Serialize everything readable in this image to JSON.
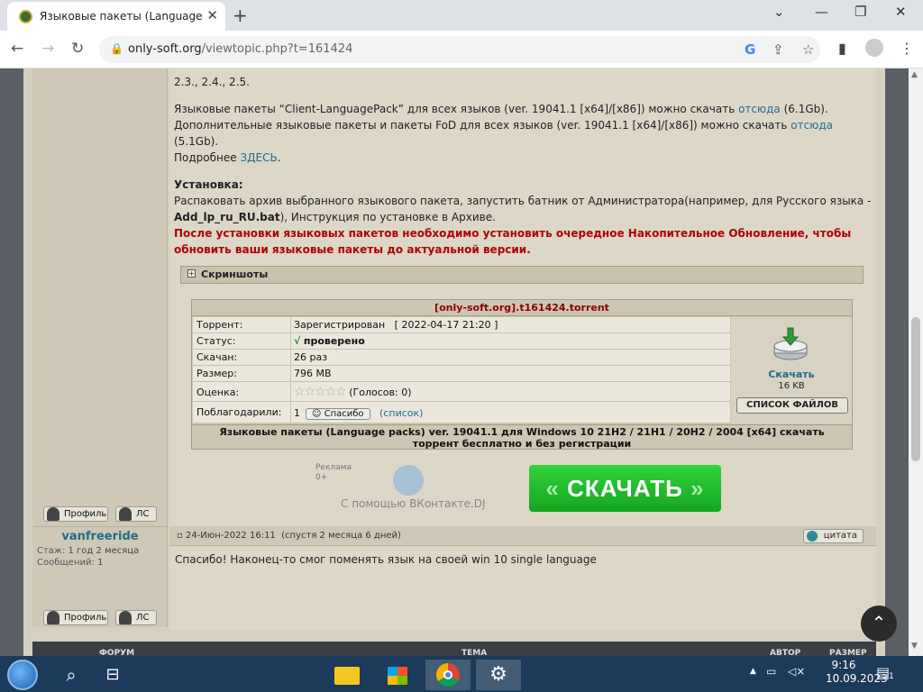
{
  "browser": {
    "tab_title": "Языковые пакеты (Language pa",
    "url_host": "only-soft.org",
    "url_path": "/viewtopic.php?t=161424"
  },
  "post": {
    "line_top": "2.3., 2.4., 2.5.",
    "lp_prefix": "Языковые пакеты “Client-LanguagePack” для всех языков (ver. 19041.1 [x64]/[x86]) можно скачать ",
    "lp_link": "отсюда",
    "lp_suffix": " (6.1Gb).",
    "fod_prefix": "Дополнительные языковые пакеты и пакеты FoD для всех языков (ver. 19041.1 [x64]/[x86]) можно скачать ",
    "fod_link": "отсюда",
    "fod_suffix": "(5.1Gb).",
    "more_prefix": "Подробнее ",
    "more_link": "ЗДЕСЬ",
    "more_suffix": ".",
    "install_title": "Установка:",
    "install_line1": "Распаковать архив выбранного языкового пакета, запустить батник от Администратора(например, для Русского языка -",
    "install_bat": "Add_lp_ru_RU.bat",
    "install_line2_suffix": "), Инструкция по установке в Архиве.",
    "warning_line1": "После установки языковых пакетов необходимо установить очередное Накопительное Обновление, чтобы",
    "warning_line2": "обновить ваши языковые пакеты до актуальной версии.",
    "spoiler_label": "Скриншоты"
  },
  "torrent": {
    "header": "[only-soft.org].t161424.torrent",
    "rows": [
      {
        "label": "Торрент:",
        "value": "Зарегистрирован   [ 2022-04-17 21:20 ]"
      },
      {
        "label": "Статус:",
        "value": "проверено"
      },
      {
        "label": "Скачан:",
        "value": "26 раз"
      },
      {
        "label": "Размер:",
        "value": "796 MB"
      },
      {
        "label": "Оценка:",
        "value": "(Голосов: 0)"
      },
      {
        "label": "Поблагодарили:",
        "value": "1"
      }
    ],
    "rating_stars": 0,
    "thanks_button": "Спасибо",
    "thanks_list": "(список)",
    "download_label": "Скачать",
    "download_size": "16 KB",
    "file_list_button": "СПИСОК ФАЙЛОВ",
    "footer_line1": "Языковые пакеты (Language packs) ver. 19041.1 для Windows 10 21H2 / 21H1 / 20H2 / 2004 [x64] скачать",
    "footer_line2": "торрент бесплатно и без регистрации"
  },
  "ad": {
    "label_line1": "Реклама",
    "label_line2": "0+",
    "caption": "С помощью ВКонтакте.DJ",
    "button_label": "СКАЧАТЬ",
    "button_color": "#1fbf2a"
  },
  "profile_buttons": {
    "profile": "Профиль",
    "pm": "ЛС"
  },
  "reply": {
    "author": "vanfreeride",
    "stage_label": "Стаж:",
    "stage_value": "1 год 2 месяца",
    "messages_label": "Сообщений:",
    "messages_value": "1",
    "date": "24-Июн-2022 16:11",
    "elapsed": "(спустя 2 месяца 6 дней)",
    "quote_button": "цитата",
    "text": "Спасибо! Наконец-то смог поменять язык на своей win 10 single language"
  },
  "table_header": {
    "forum": "ФОРУМ",
    "topic": "ТЕМА",
    "author": "АВТОР",
    "size": "РАЗМЕР"
  },
  "taskbar": {
    "time": "9:16",
    "date": "10.09.2023",
    "notification_count": "1"
  }
}
